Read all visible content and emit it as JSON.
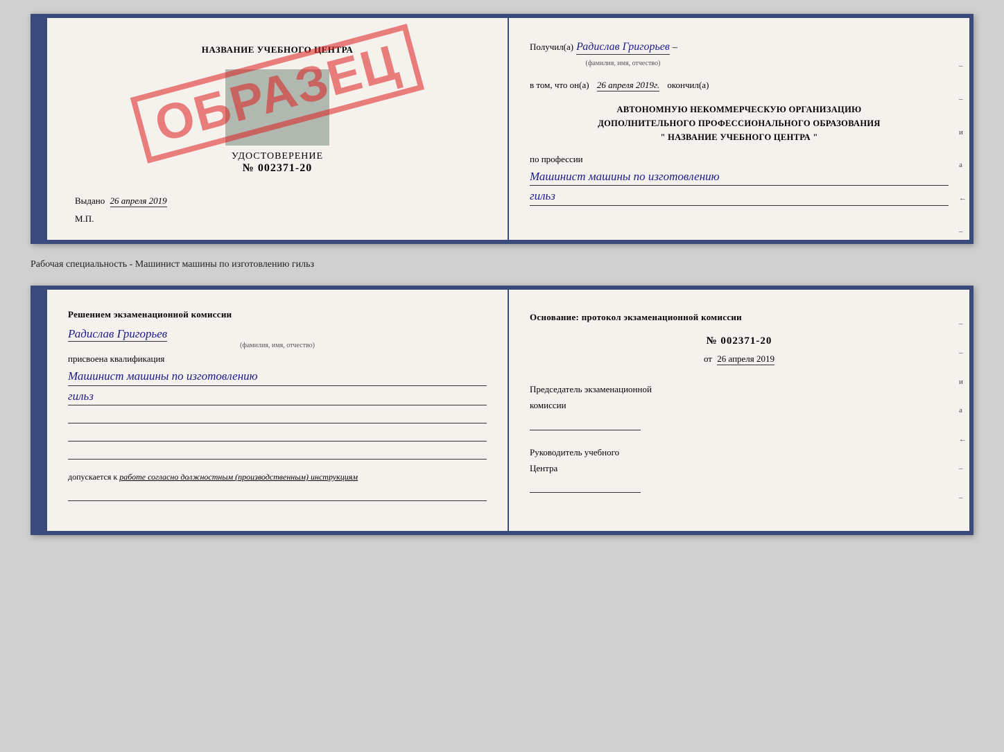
{
  "top_document": {
    "left": {
      "center_name": "НАЗВАНИЕ УЧЕБНОГО ЦЕНТРА",
      "stamp": "ОБРАЗЕЦ",
      "udostoverenie_title": "УДОСТОВЕРЕНИЕ",
      "cert_number": "№ 002371-20",
      "vydano_label": "Выдано",
      "vydano_date": "26 апреля 2019",
      "mp_label": "М.П."
    },
    "right": {
      "poluchil_label": "Получил(а)",
      "recipient_name": "Радислав Григорьев",
      "fio_label": "(фамилия, имя, отчество)",
      "v_tom_label": "в том, что он(а)",
      "completion_date": "26 апреля 2019г.",
      "okoncil_label": "окончил(а)",
      "org_line1": "АВТОНОМНУЮ НЕКОММЕРЧЕСКУЮ ОРГАНИЗАЦИЮ",
      "org_line2": "ДОПОЛНИТЕЛЬНОГО ПРОФЕССИОНАЛЬНОГО ОБРАЗОВАНИЯ",
      "org_line3": "\"   НАЗВАНИЕ УЧЕБНОГО ЦЕНТРА   \"",
      "po_professii_label": "по профессии",
      "profession": "Машинист машины по изготовлению",
      "profession2": "гильз",
      "right_marks": [
        "и",
        "а",
        "←",
        "–",
        "–",
        "–"
      ]
    }
  },
  "section_label": "Рабочая специальность - Машинист машины по изготовлению гильз",
  "bottom_document": {
    "left": {
      "resheniem_title": "Решением  экзаменационной  комиссии",
      "recipient_name": "Радислав Григорьев",
      "fio_label": "(фамилия, имя, отчество)",
      "prisvoena_label": "присвоена квалификация",
      "profession": "Машинист машины по изготовлению",
      "profession2": "гильз",
      "dopuskaetsya_prefix": "допускается к",
      "dopuskaetsya_text": "работе согласно должностным (производственным) инструкциям"
    },
    "right": {
      "osnovanie_title": "Основание: протокол экзаменационной  комиссии",
      "protocol_number": "№  002371-20",
      "ot_prefix": "от",
      "protocol_date": "26 апреля 2019",
      "predsedatel_line1": "Председатель экзаменационной",
      "predsedatel_line2": "комиссии",
      "rukovoditel_line1": "Руководитель учебного",
      "rukovoditel_line2": "Центра",
      "right_marks": [
        "и",
        "а",
        "←",
        "–",
        "–",
        "–",
        "–"
      ]
    }
  }
}
